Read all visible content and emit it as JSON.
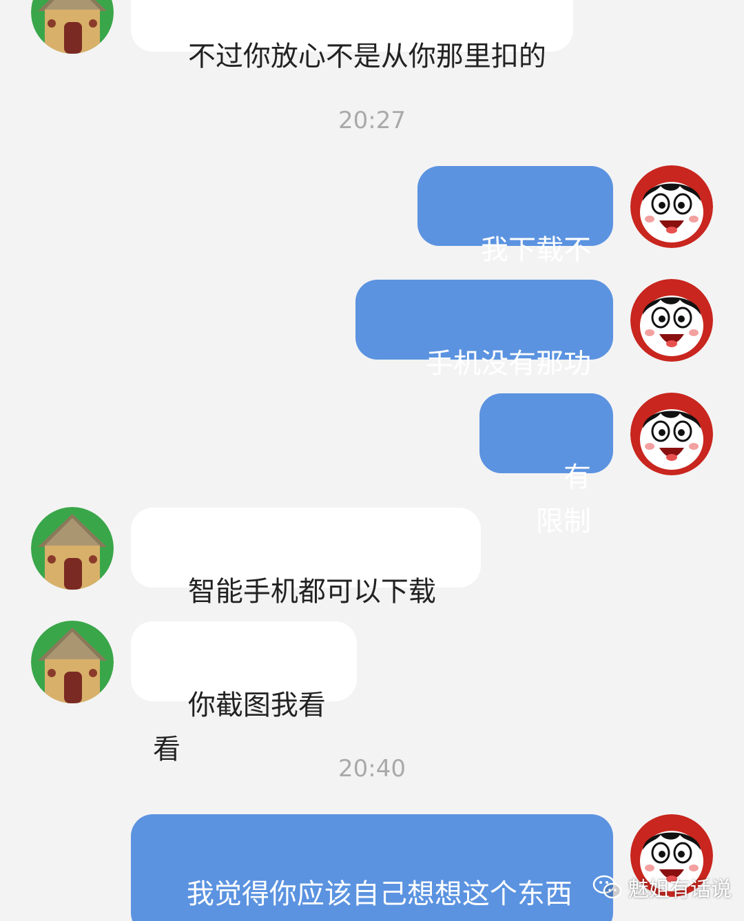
{
  "timestamps": [
    "20:27",
    "20:40"
  ],
  "messages": [
    {
      "side": "in",
      "avatar": "hut-avatar",
      "text": "不过你放心不是从你那里扣的"
    },
    {
      "side": "out",
      "avatar": "cartoon-boy-avatar",
      "text": "我下载不了"
    },
    {
      "side": "out",
      "avatar": "cartoon-boy-avatar",
      "text": "手机没有那功能"
    },
    {
      "side": "out",
      "avatar": "cartoon-boy-avatar",
      "text": "有限制"
    },
    {
      "side": "in",
      "avatar": "hut-avatar",
      "text": "智能手机都可以下载的"
    },
    {
      "side": "in",
      "avatar": "hut-avatar",
      "text": "你截图我看看"
    },
    {
      "side": "out",
      "avatar": "cartoon-boy-avatar",
      "text": "我觉得你应该自己想想这个东西\n是手工活吗"
    }
  ],
  "watermark": {
    "icon": "wechat-icon",
    "text": "魅姐有话说"
  },
  "colors": {
    "background": "#f3f3f3",
    "incoming": "#ffffff",
    "outgoing": "#5b93e0",
    "timestamp": "#a9a9a9"
  }
}
